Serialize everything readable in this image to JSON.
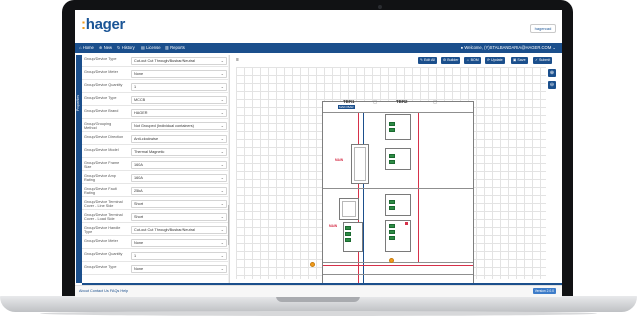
{
  "app": {
    "logo_text": "hager",
    "brand_badge": "hagercad"
  },
  "navbar": {
    "items": [
      {
        "label": "Home",
        "icon": "home-icon"
      },
      {
        "label": "New",
        "icon": "plus-icon"
      },
      {
        "label": "History",
        "icon": "history-icon"
      },
      {
        "label": "License",
        "icon": "license-icon"
      },
      {
        "label": "Reports",
        "icon": "reports-icon"
      }
    ],
    "user": "Welcome, (Y)STALBANDARIA@HAGER.COM"
  },
  "sidebar_tab": {
    "label": "Properties"
  },
  "form": {
    "rows": [
      {
        "label": "Group/Device Type",
        "value": "Cut-out Cut Through/Busbar/Neutral"
      },
      {
        "label": "Group/Device Meter",
        "value": "None"
      },
      {
        "label": "Group/Device Quantity",
        "value": "1"
      },
      {
        "label": "Group/Device Type",
        "value": "MCCB"
      },
      {
        "label": "Group/Device Brand",
        "value": "HAGER"
      },
      {
        "label": "Group/Grouping Method",
        "value": "Not Grouped (Individual containers)"
      },
      {
        "label": "Group/Device Direction",
        "value": "Anti-clockwise"
      },
      {
        "label": "Group/Device Model",
        "value": "Thermal Magnetic"
      },
      {
        "label": "Group/Device Frame Size",
        "value": "160A"
      },
      {
        "label": "Group/Device Amp Rating",
        "value": "160A"
      },
      {
        "label": "Group/Device Fault Rating",
        "value": "25kA"
      },
      {
        "label": "Group/Device Terminal Cover - Line Side",
        "value": "Short"
      },
      {
        "label": "Group/Device Terminal Cover - Load Side",
        "value": "Short"
      },
      {
        "label": "Group/Device Handle Type",
        "value": "Cut-out Cut Through/Busbar/Neutral"
      },
      {
        "label": "Group/Device Meter",
        "value": "None"
      },
      {
        "label": "Group/Device Quantity",
        "value": "1"
      },
      {
        "label": "Group/Device Type",
        "value": "None"
      }
    ]
  },
  "diagram": {
    "toolbar": [
      {
        "label": "Edit All",
        "icon": "edit-icon"
      },
      {
        "label": "Builder",
        "icon": "builder-icon"
      },
      {
        "label": "BOM",
        "icon": "bom-icon"
      },
      {
        "label": "Update",
        "icon": "update-icon"
      },
      {
        "label": "Save",
        "icon": "save-icon"
      },
      {
        "label": "Submit",
        "icon": "submit-icon"
      }
    ],
    "tbr1": "TBR1",
    "tbr2": "TBR2",
    "tbr1_tag": "MAIN BAR",
    "main_tag_1": "MAIN",
    "main_tag_2": "MAIN"
  },
  "footer": {
    "links": "About   Contact Us   FAQs   Help",
    "badge": "Version 2.0.0"
  }
}
